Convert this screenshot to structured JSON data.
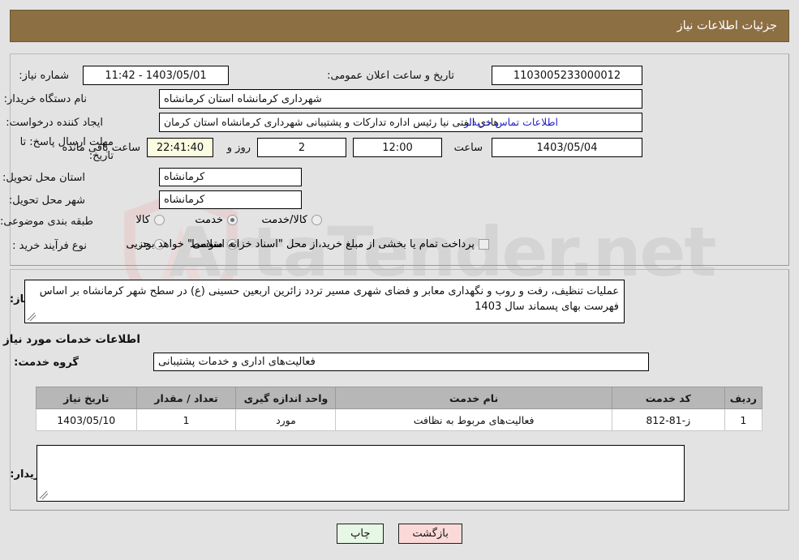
{
  "header": {
    "title": "جزئیات اطلاعات نیاز"
  },
  "form": {
    "need_number_label": "شماره نیاز:",
    "need_number_value": "1103005233000012",
    "announce_datetime_label": "تاریخ و ساعت اعلان عمومی:",
    "announce_datetime_value": "1403/05/01 - 11:42",
    "buyer_org_label": "نام دستگاه خریدار:",
    "buyer_org_value": "شهرداری کرمانشاه استان کرمانشاه",
    "requester_label": "ایجاد کننده درخواست:",
    "requester_value": "هادی الفتی نیا رئیس اداره تدارکات و پشتیبانی شهرداری کرمانشاه استان کرمان",
    "contact_link": "اطلاعات تماس خریدار",
    "deadline_label_line1": "مهلت ارسال پاسخ: تا",
    "deadline_label_line2": "تاریخ:",
    "deadline_date": "1403/05/04",
    "hour_label": "ساعت",
    "deadline_time": "12:00",
    "days_value": "2",
    "days_label": "روز و",
    "countdown_value": "22:41:40",
    "remaining_label": "ساعت باقی مانده",
    "province_label": "استان محل تحویل:",
    "province_value": "کرمانشاه",
    "city_label": "شهر محل تحویل:",
    "city_value": "کرمانشاه",
    "category_label": "طبقه بندی موضوعی:",
    "category_options": [
      {
        "label": "کالا",
        "selected": false
      },
      {
        "label": "خدمت",
        "selected": true
      },
      {
        "label": "کالا/خدمت",
        "selected": false
      }
    ],
    "process_label": "نوع فرآیند خرید :",
    "process_options": [
      {
        "label": "جزیی",
        "selected": false
      },
      {
        "label": "متوسط",
        "selected": true
      }
    ],
    "islamic_treasury_checkbox_label": "پرداخت تمام یا بخشی از مبلغ خرید،از محل \"اسناد خزانه اسلامی\" خواهد بود.",
    "islamic_treasury_checked": false
  },
  "description": {
    "label": "شرح کلی نیاز:",
    "value": "عملیات تنظیف، رفت و روب و نگهداری معابر و فضای شهری مسیر تردد زائرین اربعین حسینی (ع) در سطح شهر کرمانشاه بر اساس فهرست بهای پسماند سال 1403"
  },
  "services_section": {
    "heading": "اطلاعات خدمات مورد نیاز",
    "group_label": "گروه خدمت:",
    "group_value": "فعالیت‌های اداری و خدمات پشتیبانی",
    "table": {
      "columns": [
        "ردیف",
        "کد خدمت",
        "نام خدمت",
        "واحد اندازه گیری",
        "تعداد / مقدار",
        "تاریخ نیاز"
      ],
      "rows": [
        [
          "1",
          "ز-81-812",
          "فعالیت‌های مربوط به نظافت",
          "مورد",
          "1",
          "1403/05/10"
        ]
      ]
    }
  },
  "buyer_notes": {
    "label": "توضیحات خریدار:",
    "value": ""
  },
  "buttons": {
    "print": "چاپ",
    "back": "بازگشت"
  },
  "watermark": {
    "text": "ArtaTender.net"
  },
  "colors": {
    "header_bg": "#8d6f44",
    "page_bg": "#e3e3e3",
    "link": "#2323c8",
    "table_header_bg": "#b7b7b7",
    "countdown_bg": "#fbfbe2",
    "print_btn_bg": "#e6f7e6",
    "back_btn_bg": "#fbd9d9"
  }
}
